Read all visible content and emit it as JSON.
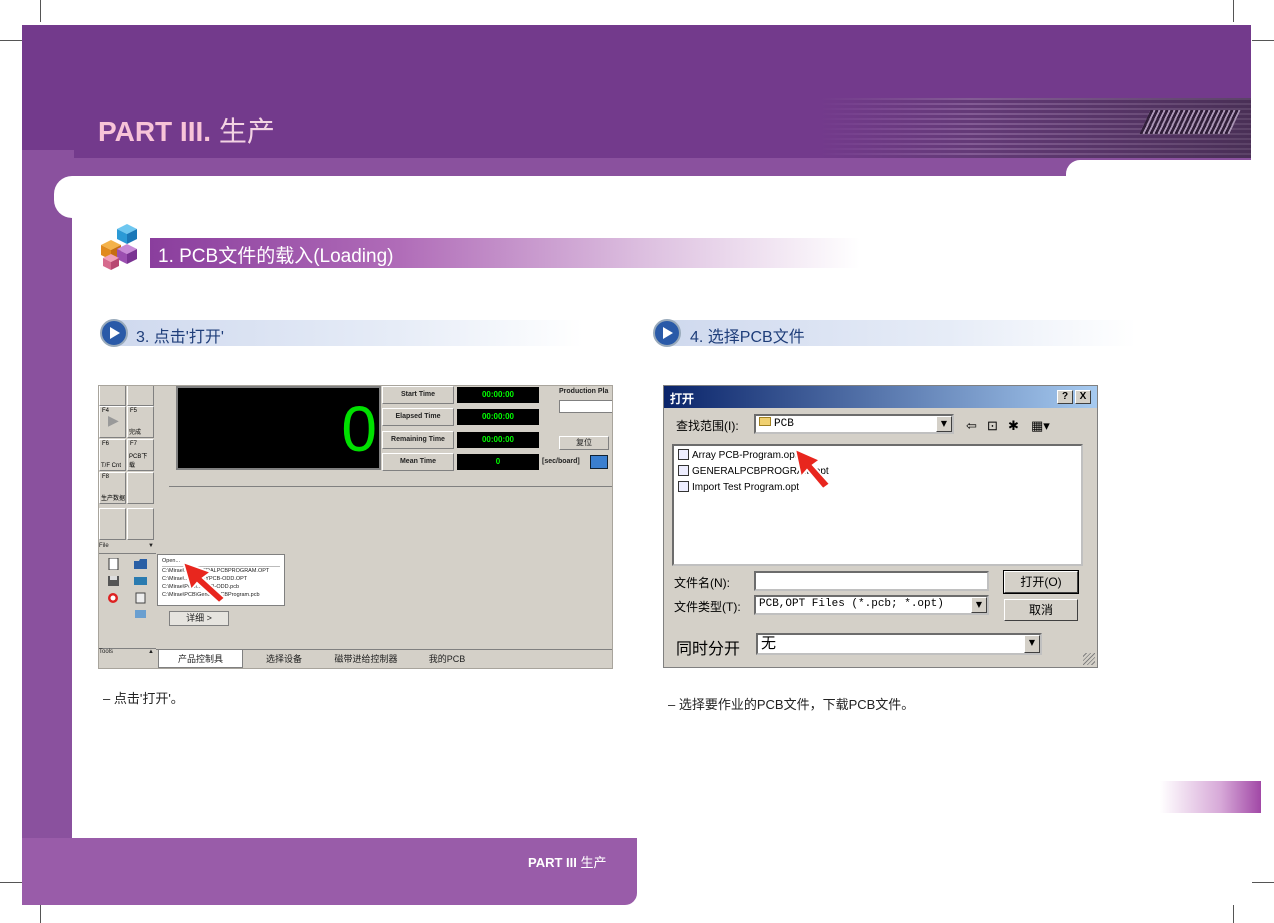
{
  "header": {
    "part_label": "PART III.",
    "part_title_cn": "生产"
  },
  "section": {
    "title": "1. PCB文件的载入(Loading)"
  },
  "step_left": {
    "title": "3. 点击'打开'",
    "caption": "– 点击'打开'。",
    "screenshot": {
      "big_counter": "0",
      "times": [
        {
          "label": "Start Time",
          "value": "00:00:00"
        },
        {
          "label": "Elapsed Time",
          "value": "00:00:00"
        },
        {
          "label": "Remaining Time",
          "value": "00:00:00"
        },
        {
          "label": "Mean Time",
          "value": "0"
        }
      ],
      "production_plan_label": "Production Pla",
      "reset_label": "复位",
      "sec_board_label": "[sec/board]",
      "fkeys": [
        {
          "key": "F4",
          "label": ""
        },
        {
          "key": "F5",
          "label": "完成"
        },
        {
          "key": "F6",
          "label": "T/F Cnt"
        },
        {
          "key": "F7",
          "label": "PCB下载"
        },
        {
          "key": "F8",
          "label": "生产数据"
        }
      ],
      "file_header": "File",
      "tools_header": "Tools",
      "popup_items": [
        "Open...",
        "C:\\Mirae\\...\\GENERALPCBPROGRAM.OPT",
        "C:\\Mirae\\...\\ARRAYPCB-ODD.OPT",
        "C:\\Mirae\\PCB\\...\\PCB-ODD.pcb",
        "C:\\Mirae\\PCB\\GeneralPCBProgram.pcb"
      ],
      "detail_button": "详细 >",
      "tabs": [
        "产品控制具",
        "选择设备",
        "磁带进给控制器",
        "我的PCB"
      ]
    }
  },
  "step_right": {
    "title": "4. 选择PCB文件",
    "caption": "– 选择要作业的PCB文件，下载PCB文件。",
    "dialog": {
      "title": "打开",
      "help_btn": "?",
      "close_btn": "X",
      "look_in_label": "查找范围(I):",
      "look_in_value": "PCB",
      "files": [
        "Array PCB-Program.opt",
        "GENERALPCBPROGRAM.opt",
        "Import Test Program.opt"
      ],
      "filename_label": "文件名(N):",
      "filename_value": "",
      "filetype_label": "文件类型(T):",
      "filetype_value": "PCB,OPT Files (*.pcb; *.opt)",
      "open_btn": "打开(O)",
      "cancel_btn": "取消",
      "simul_label": "同时分开",
      "simul_value": "无"
    }
  },
  "footer": {
    "part_label": "PART III",
    "part_title_cn": "生产"
  },
  "colors": {
    "frame_purple": "#733a8c",
    "frame_light_purple": "#8a519e",
    "accent_pink": "#f8c4d8"
  }
}
